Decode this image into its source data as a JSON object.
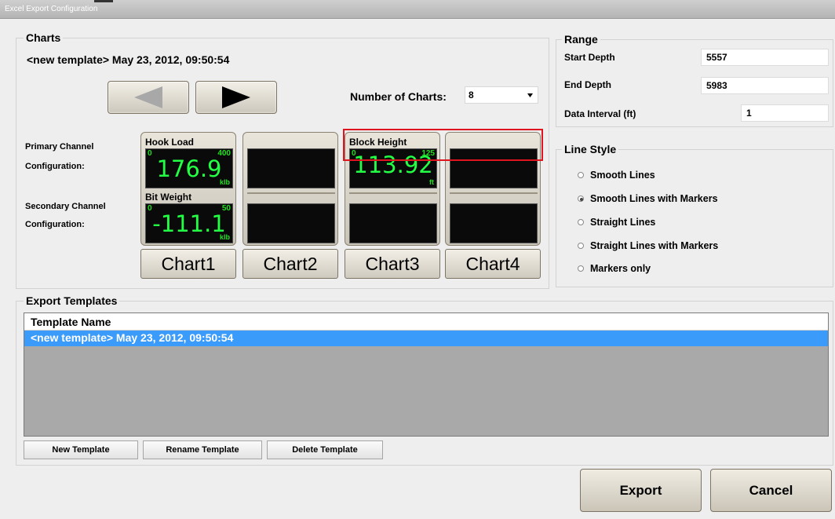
{
  "window": {
    "title": "Excel Export Configuration"
  },
  "charts": {
    "group_title": "Charts",
    "template_label": "<new template> May 23, 2012, 09:50:54",
    "number_of_charts_label": "Number of Charts:",
    "number_of_charts_value": "8",
    "primary_label_line1": "Primary Channel",
    "primary_label_line2": "Configuration:",
    "secondary_label_line1": "Secondary Channel",
    "secondary_label_line2": "Configuration:",
    "gauges": [
      {
        "top_name": "Hook Load",
        "top_min": "0",
        "top_max": "400",
        "top_value": "176.9",
        "top_unit": "klb",
        "bottom_name": "Bit Weight",
        "bottom_min": "0",
        "bottom_max": "50",
        "bottom_value": "-111.1",
        "bottom_unit": "klb",
        "button": "Chart1"
      },
      {
        "button": "Chart2"
      },
      {
        "top_name": "Block Height",
        "top_min": "0",
        "top_max": "125",
        "top_value": "113.92",
        "top_unit": "ft",
        "button": "Chart3"
      },
      {
        "button": "Chart4"
      }
    ]
  },
  "range": {
    "group_title": "Range",
    "start_depth_label": "Start Depth",
    "start_depth_value": "5557",
    "end_depth_label": "End Depth",
    "end_depth_value": "5983",
    "interval_label": "Data Interval (ft)",
    "interval_value": "1"
  },
  "line_style": {
    "group_title": "Line Style",
    "options": [
      {
        "label": "Smooth Lines",
        "selected": false
      },
      {
        "label": "Smooth Lines with Markers",
        "selected": true
      },
      {
        "label": "Straight Lines",
        "selected": false
      },
      {
        "label": "Straight Lines with Markers",
        "selected": false
      },
      {
        "label": "Markers only",
        "selected": false
      }
    ]
  },
  "templates": {
    "group_title": "Export Templates",
    "column_header": "Template Name",
    "rows": [
      "<new template> May 23, 2012, 09:50:54"
    ],
    "new_button": "New Template",
    "rename_button": "Rename Template",
    "delete_button": "Delete Template"
  },
  "footer": {
    "export_button": "Export",
    "cancel_button": "Cancel"
  },
  "colors": {
    "selection": "#3a9bfa",
    "gauge_digits": "#22ff44",
    "highlight_box": "#e0141e"
  }
}
